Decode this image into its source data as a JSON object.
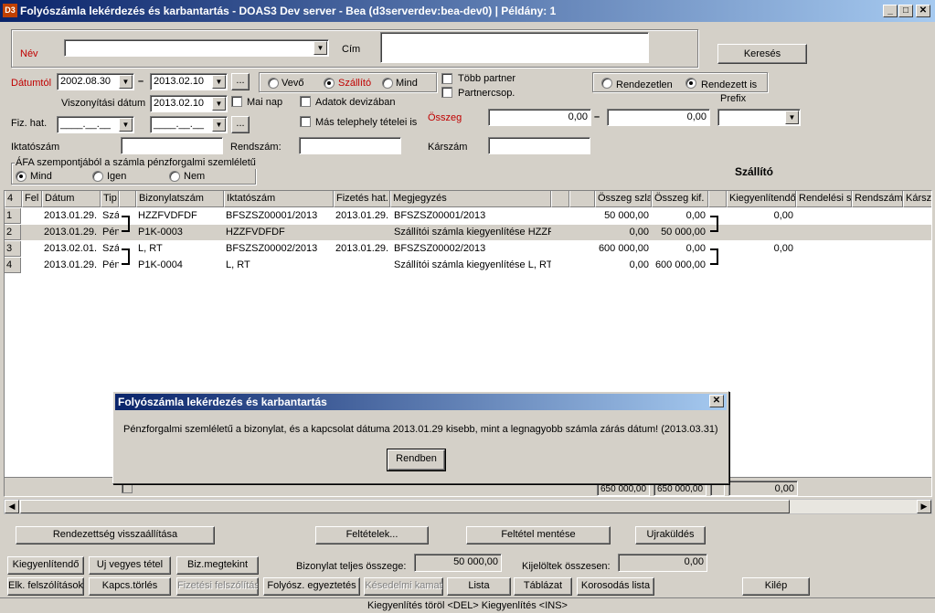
{
  "window": {
    "title": "Folyószámla lekérdezés és karbantartás - DOAS3 Dev server - Bea (d3serverdev:bea-dev0) | Példány: 1",
    "icon_text": "D3"
  },
  "filters": {
    "nev_label": "Név",
    "nev_value": "",
    "cim_label": "Cím",
    "cim_value": "",
    "search_button": "Keresés",
    "datumtol_label": "Dátumtól",
    "date_from": "2002.08.30",
    "date_to": "2013.02.10",
    "ellipsis": "...",
    "partner_radio": {
      "vevo": "Vevő",
      "szallito": "Szállító",
      "mind": "Mind",
      "selected": "szallito"
    },
    "tobb_partner": "Több partner",
    "partnercsop": "Partnercsop.",
    "rend_radio": {
      "rendezetlen": "Rendezetlen",
      "rendezett_is": "Rendezett is",
      "selected": "rendezett_is"
    },
    "prefix_label": "Prefix",
    "viszonyitasi_label": "Viszonyítási dátum",
    "viszonyitasi_date": "2013.02.10",
    "mai_nap": "Mai nap",
    "adatok_devizaban": "Adatok devizában",
    "fiz_hat_label": "Fiz. hat.",
    "fiz_hat_from": "____.__.__",
    "fiz_hat_to": "____.__.__",
    "mas_telephely": "Más telephely tételei is",
    "osszeg_label": "Összeg",
    "osszeg_from": "0,00",
    "osszeg_to": "0,00",
    "iktatoszam_label": "Iktatószám",
    "rendszam_label": "Rendszám:",
    "karszam_label": "Kárszám",
    "afa_group_label": "ÁFA szempontjából a számla pénzforgalmi szemléletű",
    "afa_radio": {
      "mind": "Mind",
      "igen": "Igen",
      "nem": "Nem",
      "selected": "mind"
    },
    "mode_label": "Szállító"
  },
  "grid": {
    "headers": [
      "4",
      "Fel",
      "Dátum",
      "Tip",
      "",
      "Bizonylatszám",
      "Iktatószám",
      "Fizetés hat.",
      "Megjegyzés",
      "",
      "",
      "Összeg szla",
      "Összeg kif.",
      "",
      "Kiegyenlítendő",
      "Rendelési s",
      "Rendszám",
      "Kársz"
    ],
    "rows": [
      {
        "num": "1",
        "datum": "2013.01.29.",
        "tip": "Szá",
        "biz": "HZZFVDFDF",
        "ikt": "BFSZSZ00001/2013",
        "fiz": "2013.01.29.",
        "megj": "BFSZSZ00001/2013",
        "osszeg_szla": "50 000,00",
        "osszeg_kif": "0,00",
        "kiegy": "0,00"
      },
      {
        "num": "2",
        "datum": "2013.01.29.",
        "tip": "Pén",
        "biz": "P1K-0003",
        "ikt": "HZZFVDFDF",
        "fiz": "",
        "megj": "Szállítói számla kiegyenlítése  HZZFV",
        "osszeg_szla": "0,00",
        "osszeg_kif": "50 000,00",
        "kiegy": ""
      },
      {
        "num": "3",
        "datum": "2013.02.01.",
        "tip": "Szá",
        "biz": "L, RT",
        "ikt": "BFSZSZ00002/2013",
        "fiz": "2013.01.29.",
        "megj": "BFSZSZ00002/2013",
        "osszeg_szla": "600 000,00",
        "osszeg_kif": "0,00",
        "kiegy": "0,00"
      },
      {
        "num": "4",
        "datum": "2013.01.29.",
        "tip": "Pén",
        "biz": "P1K-0004",
        "ikt": "L, RT",
        "fiz": "",
        "megj": "Szállítói számla kiegyenlítése  L, RT",
        "osszeg_szla": "0,00",
        "osszeg_kif": "600 000,00",
        "kiegy": ""
      }
    ],
    "totals": {
      "osszeg_szla": "650 000,00",
      "osszeg_kif": "650 000,00",
      "kiegy": "0,00"
    }
  },
  "dialog": {
    "title": "Folyószámla lekérdezés és karbantartás",
    "message": "Pénzforgalmi szemléletű a bizonylat, és a kapcsolat dátuma 2013.01.29 kisebb, mint a legnagyobb számla zárás dátum! (2013.03.31)",
    "ok_button": "Rendben"
  },
  "bottom": {
    "rendezettseg": "Rendezettség visszaállítása",
    "feltetelek": "Feltételek...",
    "feltetel_mentese": "Feltétel mentése",
    "ujrakuldes": "Ujraküldés",
    "kiegyenlitendo": "Kiegyenlítendő",
    "uj_vegyes": "Uj vegyes tétel",
    "biz_megtekint": "Biz.megtekint",
    "bizonylat_teljes_label": "Bizonylat teljes összege:",
    "bizonylat_teljes_value": "50 000,00",
    "kijeloltek_label": "Kijelöltek összesen:",
    "kijeloltek_value": "0,00",
    "elk_felszolitasok": "Elk. felszólítások",
    "kapcs_torles": "Kapcs.törlés",
    "fizetesi_felszolitas": "Fizetési felszólítás",
    "folyosz_egyeztetes": "Folyósz. egyeztetés",
    "kesedelmi_kamat": "Késedelmi kamat",
    "lista": "Lista",
    "tablazat": "Táblázat",
    "korosodas_lista": "Korosodás lista",
    "kilep": "Kilép"
  },
  "status": "Kiegyenlítés töröl <DEL>  Kiegyenlítés <INS>"
}
